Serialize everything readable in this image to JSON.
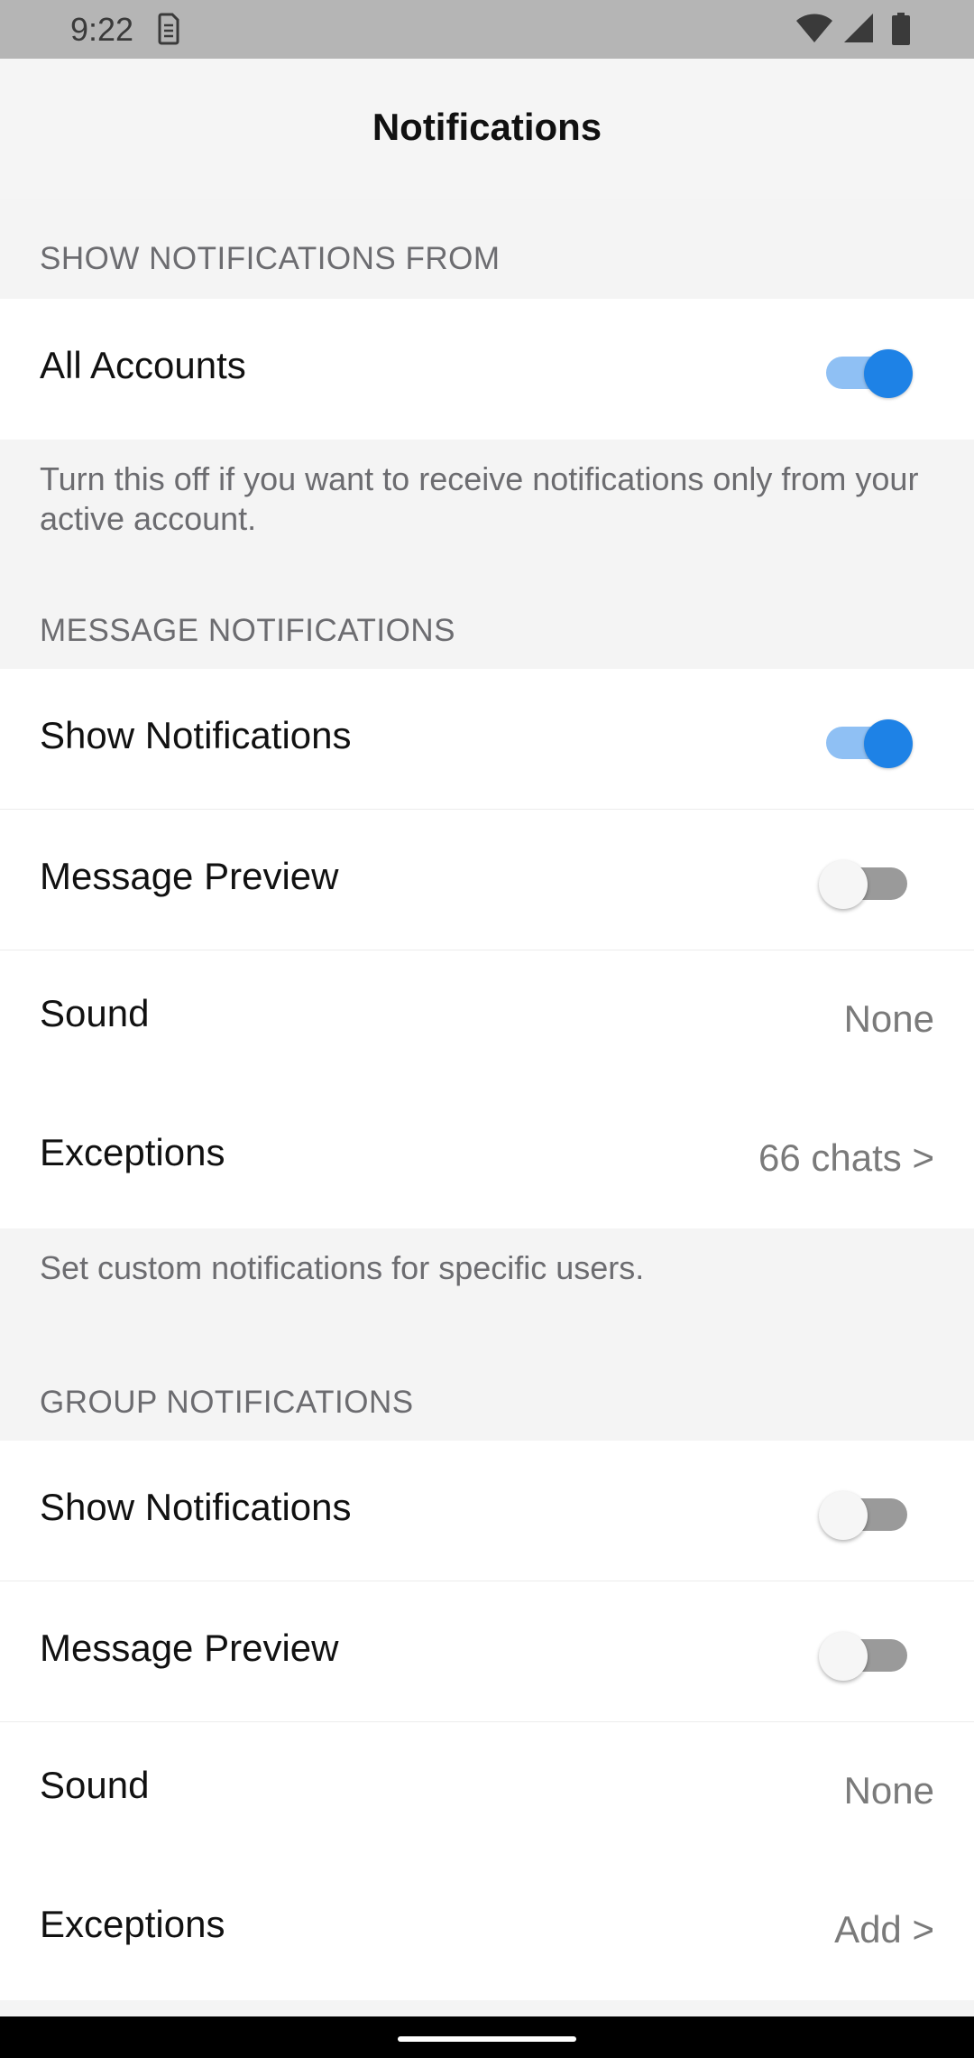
{
  "status_bar": {
    "time": "9:22",
    "icons": [
      "sim-card-icon",
      "wifi-icon",
      "cell-signal-icon",
      "battery-icon"
    ]
  },
  "header": {
    "title": "Notifications"
  },
  "sections": {
    "show_from": {
      "header": "SHOW NOTIFICATIONS FROM",
      "all_accounts": {
        "label": "All Accounts",
        "on": true
      },
      "info": "Turn this off if you want to receive notifications only from your active account."
    },
    "message": {
      "header": "MESSAGE NOTIFICATIONS",
      "show_notifications": {
        "label": "Show Notifications",
        "on": true
      },
      "message_preview": {
        "label": "Message Preview",
        "on": false
      },
      "sound": {
        "label": "Sound",
        "value": "None"
      },
      "exceptions": {
        "label": "Exceptions",
        "value": "66 chats >"
      },
      "info": "Set custom notifications for specific users."
    },
    "group": {
      "header": "GROUP NOTIFICATIONS",
      "show_notifications": {
        "label": "Show Notifications",
        "on": false
      },
      "message_preview": {
        "label": "Message Preview",
        "on": false
      },
      "sound": {
        "label": "Sound",
        "value": "None"
      },
      "exceptions": {
        "label": "Exceptions",
        "value": "Add >"
      }
    }
  },
  "colors": {
    "accent": "#1e82e6",
    "accent_track": "#8fc0f4",
    "status_bar": "#b5b5b5",
    "background": "#f4f4f4"
  }
}
